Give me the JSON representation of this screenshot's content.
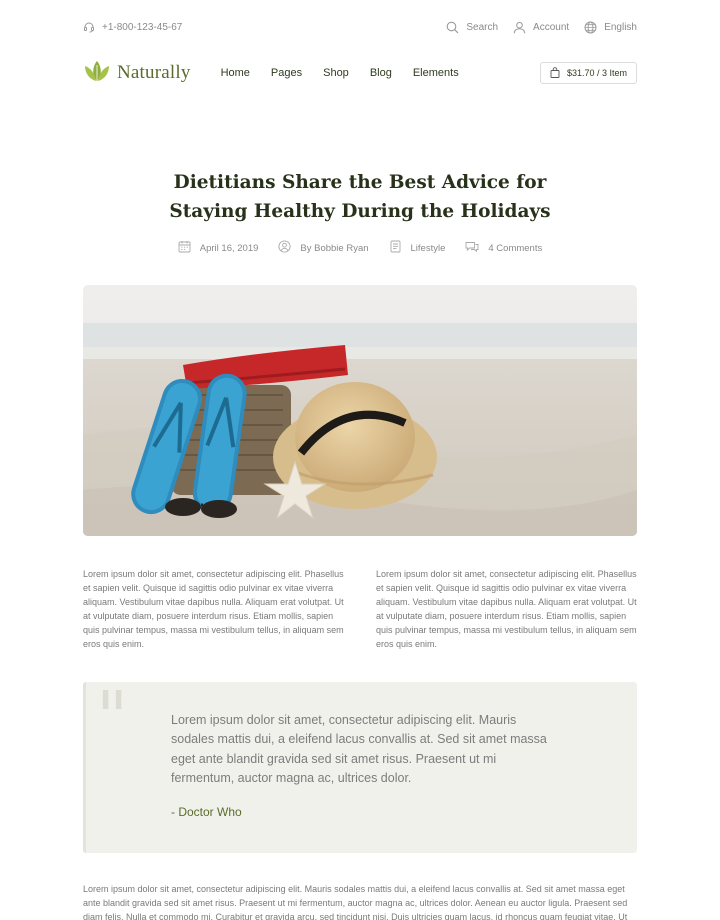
{
  "topbar": {
    "phone": "+1-800-123-45-67",
    "search": "Search",
    "account": "Account",
    "language": "English"
  },
  "header": {
    "logo": "Naturally",
    "nav": [
      "Home",
      "Pages",
      "Shop",
      "Blog",
      "Elements"
    ],
    "cart": "$31.70 / 3 Item"
  },
  "article": {
    "title_line1": "Dietitians Share the Best Advice for",
    "title_line2": "Staying Healthy During the Holidays",
    "date": "April 16, 2019",
    "author": "By Bobbie Ryan",
    "category": "Lifestyle",
    "comments": "4 Comments",
    "col1": "Lorem ipsum dolor sit amet, consectetur adipiscing elit. Phasellus et sapien velit. Quisque id sagittis odio pulvinar ex vitae viverra aliquam. Vestibulum vitae dapibus nulla. Aliquam erat volutpat. Ut at vulputate diam, posuere interdum risus. Etiam mollis, sapien quis pulvinar tempus, massa mi vestibulum tellus, in aliquam sem eros quis enim.",
    "col2": "Lorem ipsum dolor sit amet, consectetur adipiscing elit. Phasellus et sapien velit. Quisque id sagittis odio pulvinar ex vitae viverra aliquam. Vestibulum vitae dapibus nulla. Aliquam erat volutpat. Ut at vulputate diam, posuere interdum risus. Etiam mollis, sapien quis pulvinar tempus, massa mi vestibulum tellus, in aliquam sem eros quis enim.",
    "quote": "Lorem ipsum dolor sit amet, consectetur adipiscing elit. Mauris sodales mattis dui, a eleifend lacus convallis at. Sed sit amet massa eget ante blandit gravida sed sit amet risus. Praesent ut mi fermentum, auctor magna ac, ultrices dolor.",
    "quote_author": "- Doctor Who",
    "bottom": "Lorem ipsum dolor sit amet, consectetur adipiscing elit. Mauris sodales mattis dui, a eleifend lacus convallis at. Sed sit amet massa eget ante blandit gravida sed sit amet risus. Praesent ut mi fermentum, auctor magna ac, ultrices dolor. Aenean eu auctor ligula. Praesent sed diam felis. Nulla et commodo mi. Curabitur et gravida arcu, sed tincidunt nisi. Duis ultricies quam lacus, id rhoncus quam feugiat vitae. Ut ut scelerisque"
  },
  "colors": {
    "brand_green": "#5a6b2b",
    "heading": "#28321a",
    "quote_bg": "#f1f1ec"
  },
  "icons": {
    "phone": "headset-icon",
    "search": "search-icon",
    "account": "user-icon",
    "language": "globe-icon",
    "cart": "shopping-bag-icon",
    "date": "calendar-icon",
    "author": "user-circle-icon",
    "category": "document-icon",
    "comments": "chat-icon"
  }
}
